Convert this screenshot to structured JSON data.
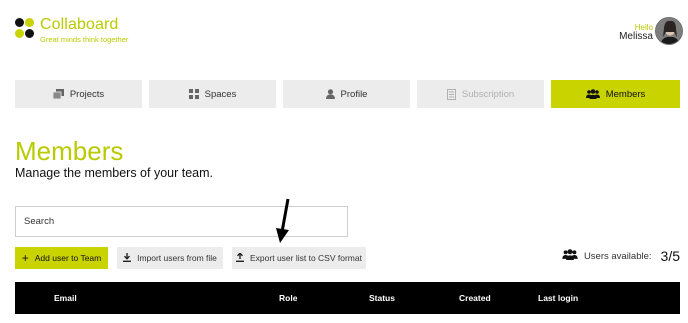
{
  "header": {
    "brand_name": "Collaboard",
    "brand_tagline": "Great minds think together",
    "greeting": "Hello",
    "user_name": "Melissa"
  },
  "tabs": [
    {
      "label": "Projects",
      "icon": "folder-stack-icon",
      "state": "normal"
    },
    {
      "label": "Spaces",
      "icon": "grid-icon",
      "state": "normal"
    },
    {
      "label": "Profile",
      "icon": "person-icon",
      "state": "normal"
    },
    {
      "label": "Subscription",
      "icon": "document-icon",
      "state": "disabled"
    },
    {
      "label": "Members",
      "icon": "group-icon",
      "state": "active"
    }
  ],
  "page": {
    "title": "Members",
    "subtitle": "Manage the members of your team."
  },
  "search": {
    "placeholder": "Search"
  },
  "actions": {
    "add_user": "Add user to Team",
    "import_users": "Import users from file",
    "export_users": "Export user list to CSV format"
  },
  "users_available": {
    "label": "Users available:",
    "count": "3/5"
  },
  "table": {
    "columns": [
      "Email",
      "Role",
      "Status",
      "Created",
      "Last login"
    ]
  },
  "colors": {
    "accent": "#c9d300",
    "accent_text": "#b9cb00",
    "tab_bg": "#ececec",
    "table_header_bg": "#000000"
  }
}
